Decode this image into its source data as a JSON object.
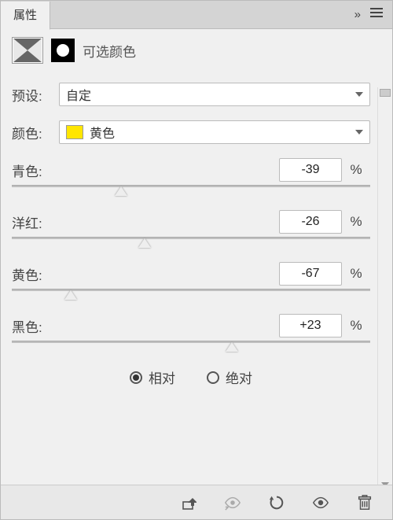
{
  "header": {
    "tab": "属性"
  },
  "panel_title": "可选颜色",
  "preset": {
    "label": "预设:",
    "value": "自定"
  },
  "color": {
    "label": "颜色:",
    "value": "黄色",
    "swatch": "#ffe600"
  },
  "sliders": [
    {
      "label": "青色:",
      "value": "-39",
      "unit": "%",
      "pos": 30.5
    },
    {
      "label": "洋红:",
      "value": "-26",
      "unit": "%",
      "pos": 37
    },
    {
      "label": "黄色:",
      "value": "-67",
      "unit": "%",
      "pos": 16.5
    },
    {
      "label": "黑色:",
      "value": "+23",
      "unit": "%",
      "pos": 61.5
    }
  ],
  "method": {
    "option1": "相对",
    "option2": "绝对",
    "selected": 0
  }
}
